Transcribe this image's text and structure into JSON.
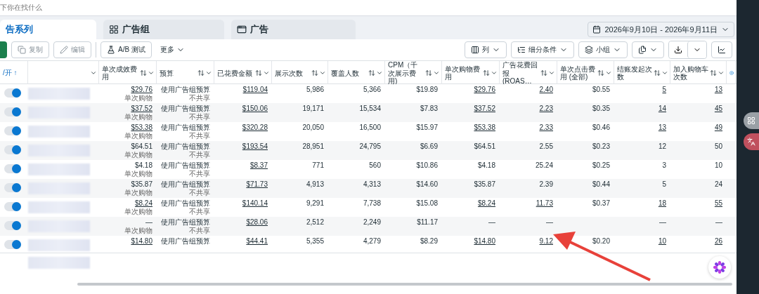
{
  "search": {
    "placeholder": "下你在找什么"
  },
  "tabs": [
    {
      "label": "告系列",
      "selected": true
    },
    {
      "label": "广告组",
      "selected": false
    },
    {
      "label": "广告",
      "selected": false
    }
  ],
  "date_range": "2026年9月10日 - 2026年9月11日",
  "toolbar_left": [
    {
      "label": "复制",
      "disabled": true
    },
    {
      "label": "编辑",
      "disabled": true
    },
    {
      "label": "A/B 测试",
      "disabled": false
    }
  ],
  "more": "更多",
  "toolbar_right": [
    {
      "kind": "menu",
      "label": "列"
    },
    {
      "kind": "menu",
      "label": "细分条件"
    },
    {
      "kind": "menu",
      "label": "小组"
    },
    {
      "kind": "menu"
    },
    {
      "kind": "split"
    },
    {
      "kind": "plain"
    }
  ],
  "table": {
    "toggle_header": "/开 ↑",
    "columns": [
      "单次成效费用",
      "预算",
      "已花费金额",
      "展示次数",
      "覆盖人数",
      "CPM（千次展示费用)",
      "单次购物费用",
      "广告花费回报 (ROAS…",
      "单次点击费用 (全部)",
      "结账发起次数",
      "加入购物车次数"
    ],
    "rows": [
      {
        "on": true,
        "linked": true,
        "cells": [
          "$29.76",
          "使用广告组预算",
          "$119.04",
          "5,986",
          "5,366",
          "$19.89",
          "$29.76",
          "2.40",
          "$0.55",
          "5",
          "13"
        ],
        "result_label": "单次购物",
        "budget_note": "不共享"
      },
      {
        "on": true,
        "linked": true,
        "cells": [
          "$37.52",
          "使用广告组预算",
          "$150.06",
          "19,171",
          "15,534",
          "$7.83",
          "$37.52",
          "2.23",
          "$0.35",
          "14",
          "45"
        ],
        "result_label": "单次购物",
        "budget_note": "不共享"
      },
      {
        "on": true,
        "linked": true,
        "cells": [
          "$53.38",
          "使用广告组预算",
          "$320.28",
          "20,050",
          "16,500",
          "$15.97",
          "$53.38",
          "2.33",
          "$0.46",
          "13",
          "49"
        ],
        "result_label": "单次购物",
        "budget_note": "不共享"
      },
      {
        "on": true,
        "linked": false,
        "cells": [
          "$64.51",
          "使用广告组预算",
          "$193.54",
          "28,951",
          "24,795",
          "$6.69",
          "$64.51",
          "2.55",
          "$0.23",
          "12",
          "50"
        ],
        "result_label": "单次购物",
        "budget_note": "不共享"
      },
      {
        "on": true,
        "linked": false,
        "cells": [
          "$4.18",
          "使用广告组预算",
          "$8.37",
          "771",
          "560",
          "$10.86",
          "$4.18",
          "25.24",
          "$0.25",
          "3",
          "10"
        ],
        "result_label": "单次购物",
        "budget_note": "不共享"
      },
      {
        "on": true,
        "linked": false,
        "cells": [
          "$35.87",
          "使用广告组预算",
          "$71.73",
          "4,913",
          "4,313",
          "$14.60",
          "$35.87",
          "2.39",
          "$0.44",
          "5",
          "24"
        ],
        "result_label": "单次购物",
        "budget_note": "不共享"
      },
      {
        "on": true,
        "linked": true,
        "cells": [
          "$8.24",
          "使用广告组预算",
          "$140.14",
          "9,291",
          "7,738",
          "$15.08",
          "$8.24",
          "11.73",
          "$0.37",
          "18",
          "55"
        ],
        "result_label": "单次购物",
        "budget_note": "不共享"
      },
      {
        "on": true,
        "linked": false,
        "cells": [
          "—",
          "使用广告组预算",
          "$28.06",
          "2,512",
          "2,249",
          "$11.17",
          "—",
          "—",
          null,
          "—",
          "—"
        ],
        "result_label": "单次购物",
        "budget_note": "不共享"
      },
      {
        "on": true,
        "linked": true,
        "cells": [
          "$14.80",
          "使用广告组预算",
          "$44.41",
          "5,355",
          "4,279",
          "$8.29",
          "$14.80",
          "9.12",
          "$0.20",
          "10",
          "26"
        ]
      }
    ]
  }
}
